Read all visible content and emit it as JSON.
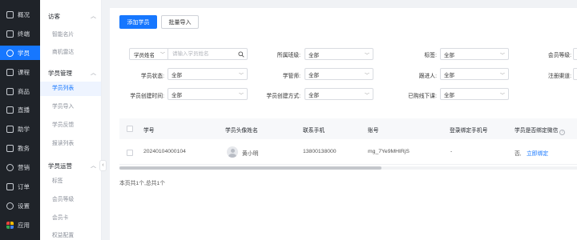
{
  "rail": [
    {
      "label": "概况",
      "icon": "home-icon"
    },
    {
      "label": "终端",
      "icon": "terminal-icon"
    },
    {
      "label": "学员",
      "icon": "user-icon",
      "active": true
    },
    {
      "label": "课程",
      "icon": "course-icon"
    },
    {
      "label": "商品",
      "icon": "goods-icon"
    },
    {
      "label": "直播",
      "icon": "live-icon"
    },
    {
      "label": "助学",
      "icon": "study-help-icon"
    },
    {
      "label": "教务",
      "icon": "academic-icon"
    },
    {
      "label": "营销",
      "icon": "marketing-icon"
    },
    {
      "label": "订单",
      "icon": "order-icon"
    },
    {
      "label": "设置",
      "icon": "settings-icon"
    },
    {
      "label": "应用",
      "icon": "apps-icon"
    }
  ],
  "subnav": {
    "groups": [
      {
        "title": "访客",
        "items": [
          "智能名片",
          "商机雷达"
        ]
      },
      {
        "title": "学员管理",
        "items": [
          "学员列表",
          "学员导入",
          "学员反馈",
          "报读列表"
        ]
      },
      {
        "title": "学员运营",
        "items": [
          "标签",
          "会员等级",
          "会员卡",
          "权益配置"
        ]
      }
    ],
    "active_item": "学员列表",
    "collapse_glyph": "‹"
  },
  "toolbar": {
    "add_label": "添加学员",
    "import_label": "批量导入"
  },
  "filters": {
    "search_type": "学员姓名",
    "search_placeholder": "请输入学员姓名",
    "class_label": "所属班级:",
    "class_value": "全部",
    "tag_label": "标签:",
    "tag_value": "全部",
    "level_label": "会员等级:",
    "status_label": "学员状态:",
    "status_value": "全部",
    "teacher_label": "学管师:",
    "teacher_value": "全部",
    "follower_label": "跟进人:",
    "follower_value": "全部",
    "channel_label": "注册渠道:",
    "created_time_label": "学员创建时间:",
    "created_time_value": "全部",
    "created_method_label": "学员创建方式:",
    "created_method_value": "全部",
    "ordered_label": "已购线下课:",
    "ordered_value": "全部"
  },
  "table": {
    "columns": [
      "学号",
      "学员头像姓名",
      "联系手机",
      "账号",
      "登录绑定手机号",
      "学员是否绑定微信"
    ],
    "rows": [
      {
        "id": "20240104000104",
        "name": "黄小明",
        "phone": "13800138000",
        "account": "mg_7Ye9MHIRjS",
        "bind_phone": "-",
        "wechat_status": "否,",
        "wechat_action": "立即绑定"
      }
    ]
  },
  "footer": {
    "summary": "本页共1个,总共1个"
  }
}
